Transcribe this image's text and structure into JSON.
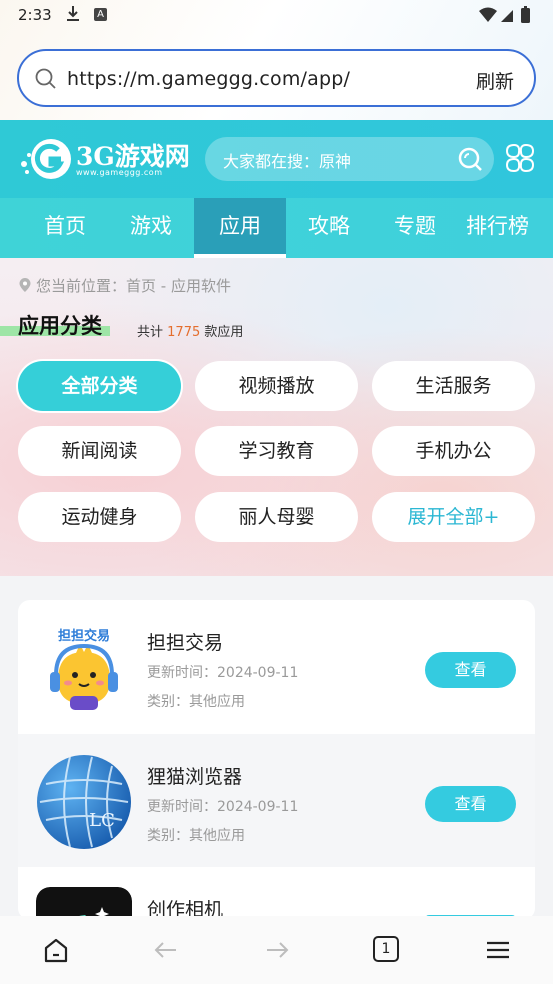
{
  "status": {
    "time": "2:33"
  },
  "url_bar": {
    "url": "https://m.gameggg.com/app/",
    "refresh_label": "刷新"
  },
  "site": {
    "logo_text": "3G游戏网",
    "logo_sub": "www.gameggg.com",
    "search_placeholder": "大家都在搜：原神"
  },
  "nav": {
    "items": [
      "首页",
      "游戏",
      "应用",
      "攻略",
      "专题",
      "排行榜"
    ],
    "active_index": 2
  },
  "category": {
    "breadcrumb": "您当前位置：首页 - 应用软件",
    "title": "应用分类",
    "count_prefix": "共计",
    "count": "1775",
    "count_suffix": "款应用",
    "chips": [
      "全部分类",
      "视频播放",
      "生活服务",
      "新闻阅读",
      "学习教育",
      "手机办公",
      "运动健身",
      "丽人母婴",
      "展开全部+"
    ]
  },
  "apps": [
    {
      "name": "担担交易",
      "date": "更新时间：2024-09-11",
      "category": "类别：其他应用",
      "button": "查看",
      "icon_text": "担担交易"
    },
    {
      "name": "狸猫浏览器",
      "date": "更新时间：2024-09-11",
      "category": "类别：其他应用",
      "button": "查看",
      "icon_text": "LC"
    },
    {
      "name": "创作相机",
      "date": "",
      "category": "",
      "button": "",
      "icon_text": ""
    }
  ],
  "bottom_bar": {
    "tab_count": "1"
  },
  "colors": {
    "accent": "#34cbe0",
    "header": "#2fc9d6",
    "nav_active": "#2a9fb8",
    "url_border": "#3b6fd6"
  }
}
